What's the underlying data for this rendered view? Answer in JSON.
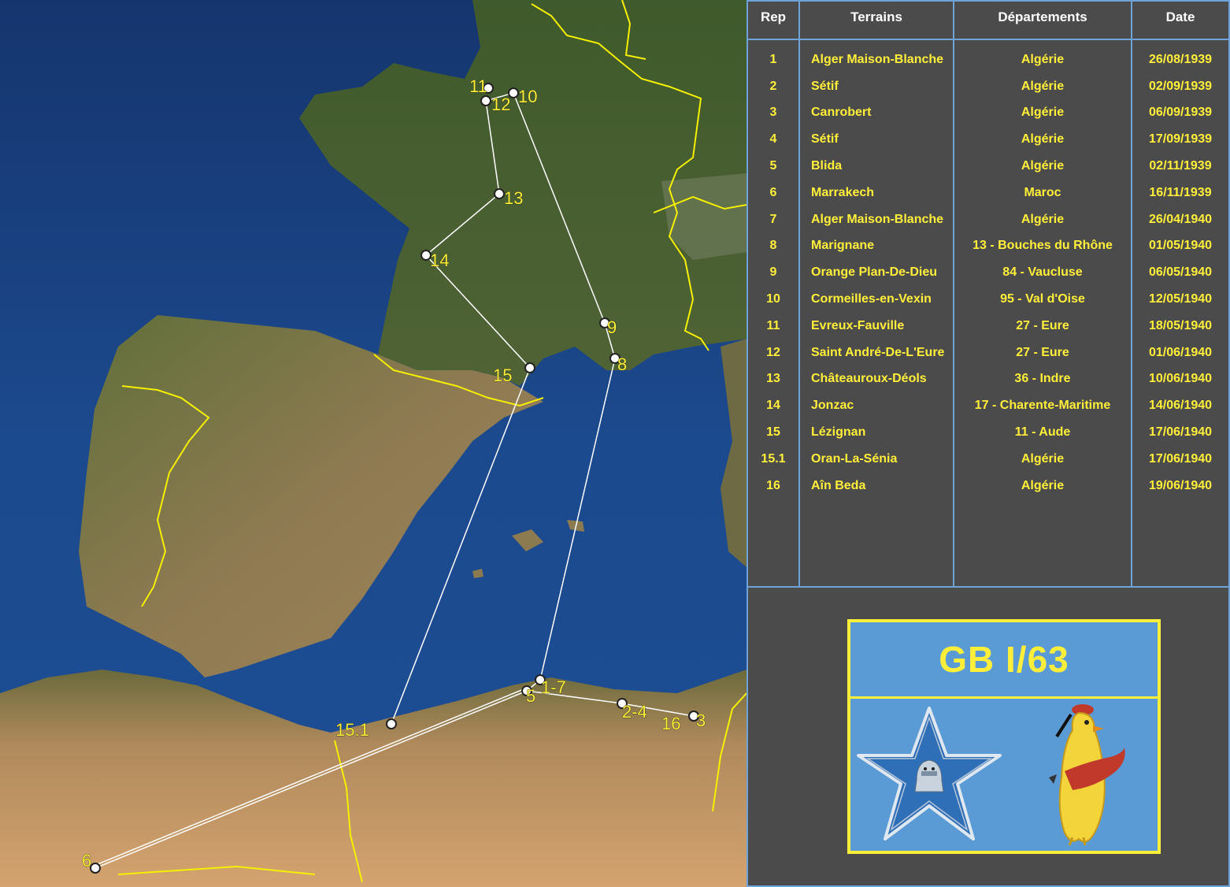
{
  "map": {
    "waypoints": [
      {
        "label": "1-7"
      },
      {
        "label": "2-4"
      },
      {
        "label": "3"
      },
      {
        "label": "5"
      },
      {
        "label": "6"
      },
      {
        "label": "8"
      },
      {
        "label": "9"
      },
      {
        "label": "10"
      },
      {
        "label": "11"
      },
      {
        "label": "12"
      },
      {
        "label": "13"
      },
      {
        "label": "14"
      },
      {
        "label": "15"
      },
      {
        "label": "15.1"
      },
      {
        "label": "16"
      }
    ],
    "route_color": "#ffffff",
    "border_color": "#f5f000",
    "label_color": "#ffef3a"
  },
  "table": {
    "headers": {
      "rep": "Rep",
      "terrains": "Terrains",
      "departements": "Départements",
      "date": "Date"
    },
    "rows": [
      {
        "rep": "1",
        "terrain": "Alger Maison-Blanche",
        "dep": "Algérie",
        "date": "26/08/1939"
      },
      {
        "rep": "2",
        "terrain": "Sétif",
        "dep": "Algérie",
        "date": "02/09/1939"
      },
      {
        "rep": "3",
        "terrain": "Canrobert",
        "dep": "Algérie",
        "date": "06/09/1939"
      },
      {
        "rep": "4",
        "terrain": "Sétif",
        "dep": "Algérie",
        "date": "17/09/1939"
      },
      {
        "rep": "5",
        "terrain": "Blida",
        "dep": "Algérie",
        "date": "02/11/1939"
      },
      {
        "rep": "6",
        "terrain": "Marrakech",
        "dep": "Maroc",
        "date": "16/11/1939"
      },
      {
        "rep": "7",
        "terrain": "Alger Maison-Blanche",
        "dep": "Algérie",
        "date": "26/04/1940"
      },
      {
        "rep": "8",
        "terrain": "Marignane",
        "dep": "13 - Bouches du Rhône",
        "date": "01/05/1940"
      },
      {
        "rep": "9",
        "terrain": "Orange Plan-De-Dieu",
        "dep": "84 - Vaucluse",
        "date": "06/05/1940"
      },
      {
        "rep": "10",
        "terrain": "Cormeilles-en-Vexin",
        "dep": "95 - Val d'Oise",
        "date": "12/05/1940"
      },
      {
        "rep": "11",
        "terrain": "Evreux-Fauville",
        "dep": "27 - Eure",
        "date": "18/05/1940"
      },
      {
        "rep": "12",
        "terrain": "Saint André-De-L'Eure",
        "dep": "27 - Eure",
        "date": "01/06/1940"
      },
      {
        "rep": "13",
        "terrain": "Châteauroux-Déols",
        "dep": "36 - Indre",
        "date": "10/06/1940"
      },
      {
        "rep": "14",
        "terrain": "Jonzac",
        "dep": "17 - Charente-Maritime",
        "date": "14/06/1940"
      },
      {
        "rep": "15",
        "terrain": "Lézignan",
        "dep": "11 - Aude",
        "date": "17/06/1940"
      },
      {
        "rep": "15.1",
        "terrain": "Oran-La-Sénia",
        "dep": "Algérie",
        "date": "17/06/1940"
      },
      {
        "rep": "16",
        "terrain": "Aîn Beda",
        "dep": "Algérie",
        "date": "19/06/1940"
      }
    ],
    "text_color": "#ffef3a",
    "header_color": "#ffffff",
    "grid_color": "#6fa3d8"
  },
  "badge": {
    "title": "GB I/63",
    "background": "#5b9bd5",
    "accent": "#ffef3a",
    "emblems": [
      "star-emblem-icon",
      "bird-mascot-icon"
    ]
  }
}
